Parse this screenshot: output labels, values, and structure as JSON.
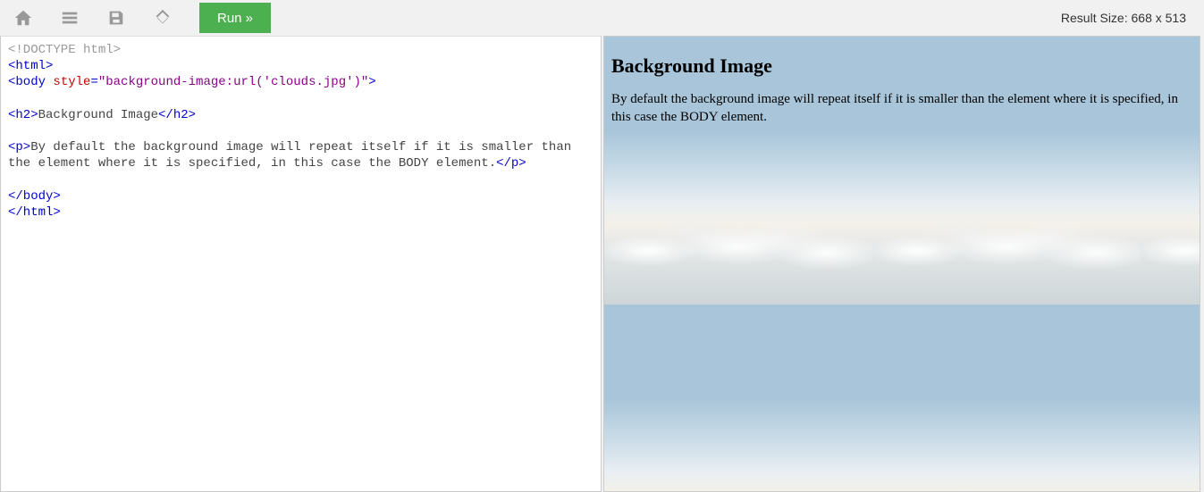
{
  "toolbar": {
    "run_label": "Run »",
    "result_size_label": "Result Size:",
    "result_width": "668",
    "result_height": "513"
  },
  "editor": {
    "code_plain": "<!DOCTYPE html>\n<html>\n<body style=\"background-image:url('clouds.jpg')\">\n\n<h2>Background Image</h2>\n\n<p>By default the background image will repeat itself if it is smaller than the element where it is specified, in this case the BODY element.</p>\n\n</body>\n</html>",
    "lines": [
      {
        "tokens": [
          {
            "cls": "t-doc",
            "txt": "<!DOCTYPE html>"
          }
        ]
      },
      {
        "tokens": [
          {
            "cls": "t-tag",
            "txt": "<html>"
          }
        ]
      },
      {
        "tokens": [
          {
            "cls": "t-tag",
            "txt": "<body"
          },
          {
            "cls": "t-txt",
            "txt": " "
          },
          {
            "cls": "t-attr",
            "txt": "style"
          },
          {
            "cls": "t-tag",
            "txt": "="
          },
          {
            "cls": "t-val",
            "txt": "\"background-image:url('clouds.jpg')\""
          },
          {
            "cls": "t-tag",
            "txt": ">"
          }
        ]
      },
      {
        "tokens": []
      },
      {
        "tokens": [
          {
            "cls": "t-tag",
            "txt": "<h2>"
          },
          {
            "cls": "t-txt",
            "txt": "Background Image"
          },
          {
            "cls": "t-tag",
            "txt": "</h2>"
          }
        ]
      },
      {
        "tokens": []
      },
      {
        "tokens": [
          {
            "cls": "t-tag",
            "txt": "<p>"
          },
          {
            "cls": "t-txt",
            "txt": "By default the background image will repeat itself if it is smaller than the element where it is specified, in this case the BODY element."
          },
          {
            "cls": "t-tag",
            "txt": "</p>"
          }
        ]
      },
      {
        "tokens": []
      },
      {
        "tokens": [
          {
            "cls": "t-tag",
            "txt": "</body>"
          }
        ]
      },
      {
        "tokens": [
          {
            "cls": "t-tag",
            "txt": "</html>"
          }
        ]
      }
    ]
  },
  "result": {
    "heading": "Background Image",
    "paragraph": "By default the background image will repeat itself if it is smaller than the element where it is specified, in this case the BODY element."
  }
}
